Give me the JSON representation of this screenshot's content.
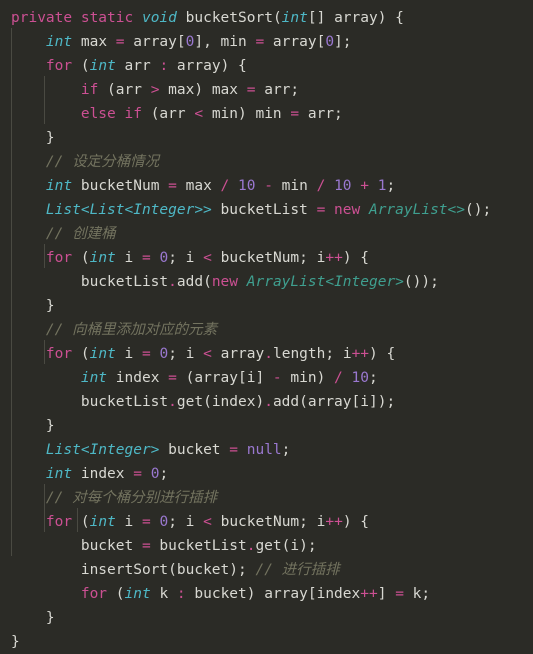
{
  "editor": {
    "language": "Java",
    "theme": "darcula-dark",
    "background_color": "#2b2b26",
    "font_size_px": 14.5,
    "line_height_px": 24,
    "colors": {
      "keyword": "#cc5093",
      "type": "#4eb8c6",
      "class": "#3f9f8f",
      "number": "#9a78d0",
      "operator": "#cc5093",
      "plain": "#d8d8d2",
      "comment": "#73735f",
      "indent_guide": "#4a4a42"
    }
  },
  "code": {
    "lines": [
      "private static void bucketSort(int[] array) {",
      "    int max = array[0], min = array[0];",
      "    for (int arr : array) {",
      "        if (arr > max) max = arr;",
      "        else if (arr < min) min = arr;",
      "    }",
      "    // 设定分桶情况",
      "    int bucketNum = max / 10 - min / 10 + 1;",
      "    List<List<Integer>> bucketList = new ArrayList<>();",
      "    // 创建桶",
      "    for (int i = 0; i < bucketNum; i++) {",
      "        bucketList.add(new ArrayList<Integer>());",
      "    }",
      "    // 向桶里添加对应的元素",
      "    for (int i = 0; i < array.length; i++) {",
      "        int index = (array[i] - min) / 10;",
      "        bucketList.get(index).add(array[i]);",
      "    }",
      "    List<Integer> bucket = null;",
      "    int index = 0;",
      "    // 对每个桶分别进行插排",
      "    for (int i = 0; i < bucketNum; i++) {",
      "        bucket = bucketList.get(i);",
      "        insertSort(bucket); // 进行插排",
      "        for (int k : bucket) array[index++] = k;",
      "    }",
      "}"
    ],
    "tokens": {
      "l1": {
        "kw_private": "private",
        "kw_static": "static",
        "type_void": "void",
        "fn_name": "bucketSort",
        "type_int": "int",
        "param": "array"
      },
      "comments": [
        "// 设定分桶情况",
        "// 创建桶",
        "// 向桶里添加对应的元素",
        "// 对每个桶分别进行插排",
        "// 进行插排"
      ],
      "numbers": [
        "0",
        "10",
        "1",
        "null"
      ],
      "types": [
        "int",
        "void",
        "List<List<Integer>>",
        "List<Integer>"
      ],
      "classes": [
        "ArrayList<>",
        "ArrayList<Integer>"
      ],
      "keywords": [
        "private",
        "static",
        "for",
        "if",
        "else",
        "new"
      ],
      "identifiers": [
        "bucketSort",
        "array",
        "max",
        "min",
        "arr",
        "bucketNum",
        "bucketList",
        "i",
        "index",
        "bucket",
        "k",
        "length",
        "add",
        "get",
        "insertSort"
      ]
    }
  }
}
